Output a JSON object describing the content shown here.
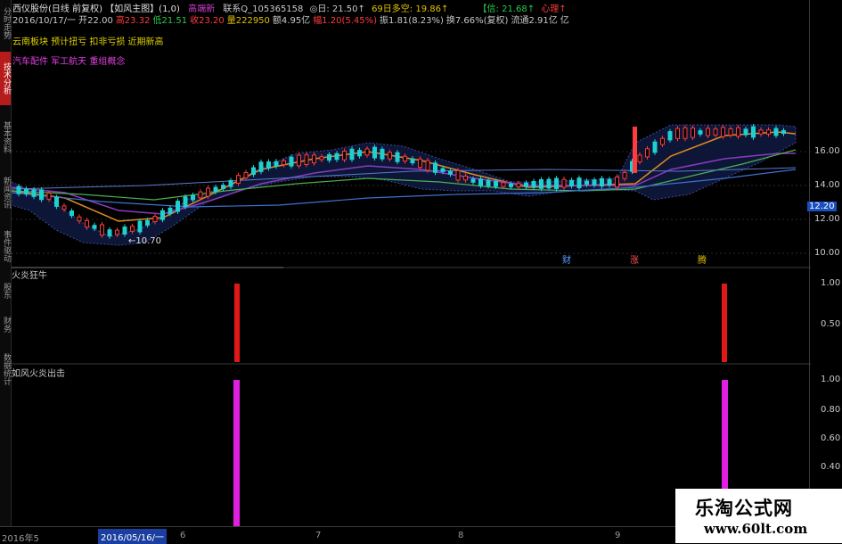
{
  "stock_header": {
    "line1_prefix": "西仪股份(日线 前复权)",
    "main_title": "【如风主图】(1,0)",
    "tag1": "高端新",
    "tag2": "联系Q_105365158",
    "tag3": "◎日: 21.50↑",
    "tag4": "69日多空: 19.86↑",
    "tag5": "【信: 21.68↑",
    "tag6": "心理↑",
    "line2": [
      {
        "text": "2016/10/17/一 开22.00",
        "color": "#c8c8c8"
      },
      {
        "text": "高23.32",
        "color": "#ff3b3b"
      },
      {
        "text": "低21.51",
        "color": "#29c94a"
      },
      {
        "text": "收23.20",
        "color": "#ff3b3b"
      },
      {
        "text": "量222950",
        "color": "#e0c000"
      },
      {
        "text": "额4.95亿",
        "color": "#c8c8c8"
      },
      {
        "text": "幅1.20(5.45%)",
        "color": "#ff3b3b"
      },
      {
        "text": "振1.81(8.23%)",
        "color": "#c8c8c8"
      },
      {
        "text": "换7.66%(复权)",
        "color": "#c8c8c8"
      },
      {
        "text": "流通2.91亿",
        "color": "#c8c8c8"
      },
      {
        "text": "亿",
        "color": "#c8c8c8"
      }
    ],
    "concepts1": "云南板块 预计扭亏 扣非亏损 近期新高",
    "concepts2": "汽车配件 军工航天 重组概念"
  },
  "sidebar": {
    "tabs": [
      {
        "label": "分时走势",
        "active": false
      },
      {
        "label": "技术分析",
        "active": true
      },
      {
        "label": "基本资料",
        "active": false
      },
      {
        "label": "新闻资讯",
        "active": false
      },
      {
        "label": "事件驱动",
        "active": false
      },
      {
        "label": "股东",
        "active": false
      },
      {
        "label": "财务",
        "active": false
      },
      {
        "label": "数据统计",
        "active": false
      }
    ]
  },
  "main_chart": {
    "low_marker": "←10.70",
    "event_markers": [
      "财",
      "涨",
      "腾"
    ],
    "y_ticks": [
      "16.00",
      "14.00",
      "12.00",
      "10.00"
    ],
    "price_flag": "12.20"
  },
  "indicator1": {
    "title": "火炎狂牛",
    "y_ticks": [
      "1.00",
      "0.50"
    ],
    "bar_color": "#e01818"
  },
  "indicator2": {
    "title": "如风火炎出击",
    "y_ticks": [
      "1.00",
      "0.80",
      "0.60",
      "0.40"
    ],
    "bar_color": "#e020e0"
  },
  "bottom_axis": {
    "dates": [
      "2016年5",
      "2016/05/16/一",
      "6",
      "7",
      "8",
      "9"
    ]
  },
  "watermark": {
    "title": "乐淘公式网",
    "url": "www.60lt.com"
  },
  "colors": {
    "up": "#ff3b3b",
    "down": "#20d0d0",
    "ma_orange": "#e08a20",
    "ma_green": "#4caf50",
    "ma_blue": "#3f6fd0",
    "band": "#6a2a8a"
  }
}
